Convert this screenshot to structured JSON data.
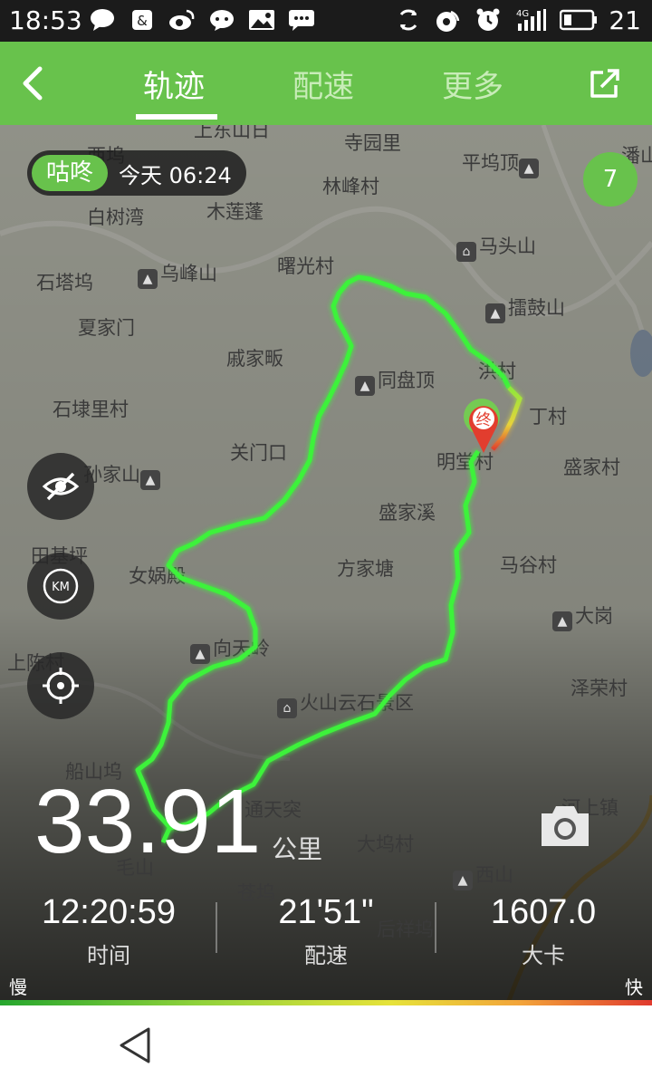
{
  "statusbar": {
    "time": "18:53",
    "battery": "21",
    "left_icons": [
      "message-icon",
      "shopping-bag-icon",
      "weibo-icon",
      "chat-icon",
      "image-icon",
      "sms-icon"
    ],
    "right_icons": [
      "sync-icon",
      "wifi-icon",
      "alarm-icon",
      "signal-4g-icon",
      "battery-icon"
    ],
    "network_label": "4G"
  },
  "topbar": {
    "tabs": [
      {
        "label": "轨迹",
        "active": true
      },
      {
        "label": "配速",
        "active": false
      },
      {
        "label": "更多",
        "active": false
      }
    ],
    "accent_color": "#68c24c"
  },
  "map": {
    "user_name": "咕咚",
    "date_label": "今天 06:24",
    "cluster_count": "7",
    "end_label": "终",
    "places": [
      {
        "name": "上东山日",
        "icon": false
      },
      {
        "name": "寺园里",
        "icon": false
      },
      {
        "name": "平坞顶",
        "icon": true
      },
      {
        "name": "潘山",
        "icon": false
      },
      {
        "name": "西坞",
        "icon": false
      },
      {
        "name": "白树湾",
        "icon": false
      },
      {
        "name": "木莲蓬",
        "icon": false
      },
      {
        "name": "林峰村",
        "icon": false
      },
      {
        "name": "马头山",
        "icon": true
      },
      {
        "name": "石塔坞",
        "icon": false
      },
      {
        "name": "乌峰山",
        "icon": true
      },
      {
        "name": "曙光村",
        "icon": false
      },
      {
        "name": "擂鼓山",
        "icon": true
      },
      {
        "name": "夏家门",
        "icon": false
      },
      {
        "name": "戚家畈",
        "icon": false
      },
      {
        "name": "同盘顶",
        "icon": true
      },
      {
        "name": "洪村",
        "icon": false
      },
      {
        "name": "石埭里村",
        "icon": false
      },
      {
        "name": "丁村",
        "icon": false
      },
      {
        "name": "关门口",
        "icon": false
      },
      {
        "name": "明堂村",
        "icon": false
      },
      {
        "name": "盛家村",
        "icon": false
      },
      {
        "name": "孙家山",
        "icon": true
      },
      {
        "name": "盛家溪",
        "icon": false
      },
      {
        "name": "田基坪",
        "icon": false
      },
      {
        "name": "方家塘",
        "icon": false
      },
      {
        "name": "马谷村",
        "icon": false
      },
      {
        "name": "女娲殿",
        "icon": false
      },
      {
        "name": "大岗",
        "icon": true
      },
      {
        "name": "向天岭",
        "icon": true
      },
      {
        "name": "上陈村",
        "icon": false
      },
      {
        "name": "泽荣村",
        "icon": false
      },
      {
        "name": "火山云石景区",
        "icon": true
      },
      {
        "name": "船山坞",
        "icon": false
      },
      {
        "name": "通天突",
        "icon": false
      },
      {
        "name": "河上镇",
        "icon": false
      },
      {
        "name": "大坞村",
        "icon": false
      },
      {
        "name": "毛山",
        "icon": false
      },
      {
        "name": "西山",
        "icon": true
      },
      {
        "name": "苍坞",
        "icon": false
      },
      {
        "name": "后祥坞",
        "icon": false
      }
    ]
  },
  "stats": {
    "distance": "33.91",
    "distance_unit": "公里",
    "duration_value": "12:20:59",
    "duration_label": "时间",
    "pace_value": "21'51\"",
    "pace_label": "配速",
    "calories_value": "1607.0",
    "calories_label": "大卡",
    "slow_label": "慢",
    "fast_label": "快"
  }
}
